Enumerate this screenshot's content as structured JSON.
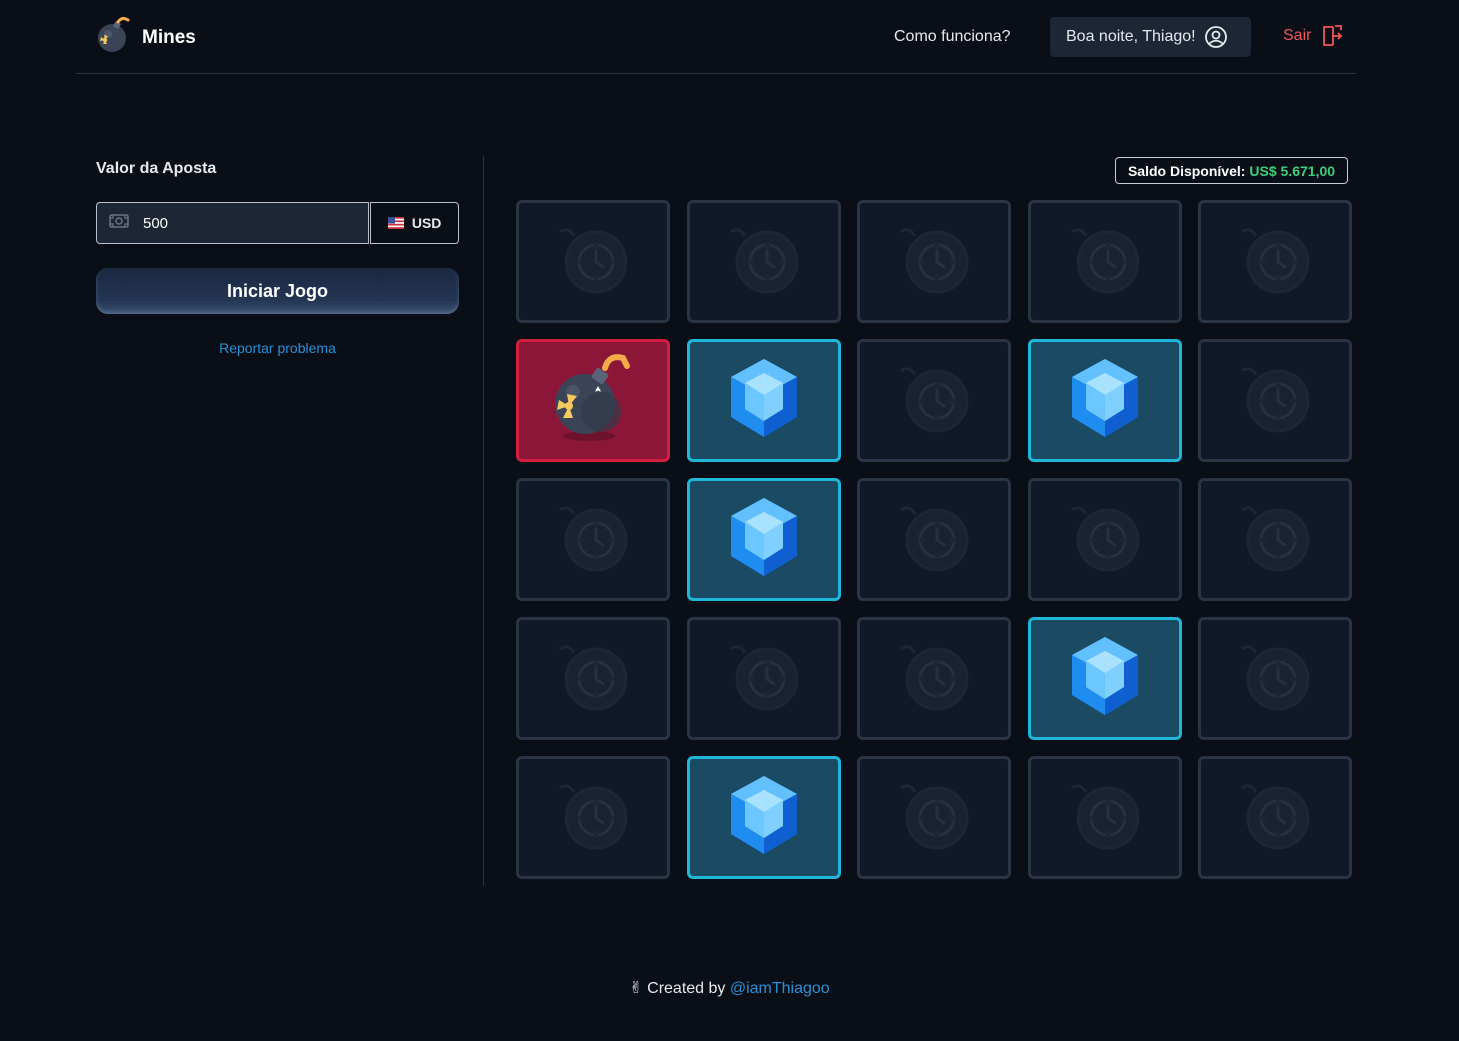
{
  "header": {
    "app_name": "Mines",
    "logo_icon": "bomb-icon",
    "nav_link": "Como funciona?",
    "greeting": "Boa noite, Thiago!",
    "user_icon": "user-circle-icon",
    "logout_label": "Sair",
    "logout_icon": "logout-icon"
  },
  "sidebar": {
    "bet_label": "Valor da Aposta",
    "bet_value": "500",
    "money_icon": "banknote-icon",
    "currency": "USD",
    "currency_flag": "us-flag-icon",
    "start_button": "Iniciar Jogo",
    "report_link": "Reportar problema"
  },
  "balance": {
    "label": "Saldo Disponível:",
    "value": "US$ 5.671,00"
  },
  "board": {
    "rows": 5,
    "cols": 5,
    "tiles": [
      "hidden",
      "hidden",
      "hidden",
      "hidden",
      "hidden",
      "bomb",
      "gem",
      "hidden",
      "gem",
      "hidden",
      "hidden",
      "gem",
      "hidden",
      "hidden",
      "hidden",
      "hidden",
      "hidden",
      "hidden",
      "gem",
      "hidden",
      "hidden",
      "gem",
      "hidden",
      "hidden",
      "hidden"
    ]
  },
  "footer": {
    "emoji": "✌",
    "text": "Created by",
    "handle": "@iamThiagoo"
  },
  "colors": {
    "background": "#0a0f17",
    "gem_tile_border": "#1fb6d8",
    "bomb_tile_border": "#d11f3f",
    "balance_value": "#3cd07a",
    "logout": "#f0565c",
    "link": "#2b8fd6"
  }
}
